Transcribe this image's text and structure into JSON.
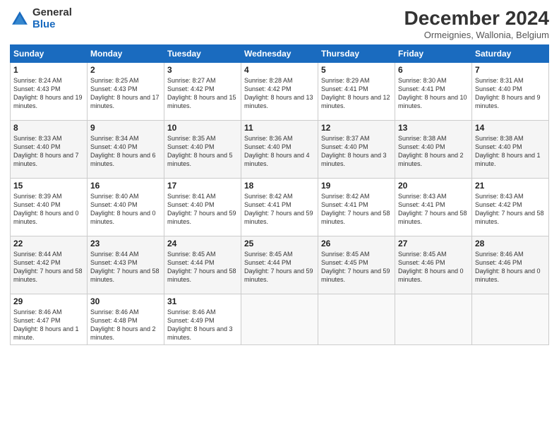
{
  "logo": {
    "general": "General",
    "blue": "Blue"
  },
  "header": {
    "month": "December 2024",
    "location": "Ormeignies, Wallonia, Belgium"
  },
  "weekdays": [
    "Sunday",
    "Monday",
    "Tuesday",
    "Wednesday",
    "Thursday",
    "Friday",
    "Saturday"
  ],
  "weeks": [
    [
      {
        "day": "1",
        "sunrise": "8:24 AM",
        "sunset": "4:43 PM",
        "daylight": "8 hours and 19 minutes."
      },
      {
        "day": "2",
        "sunrise": "8:25 AM",
        "sunset": "4:43 PM",
        "daylight": "8 hours and 17 minutes."
      },
      {
        "day": "3",
        "sunrise": "8:27 AM",
        "sunset": "4:42 PM",
        "daylight": "8 hours and 15 minutes."
      },
      {
        "day": "4",
        "sunrise": "8:28 AM",
        "sunset": "4:42 PM",
        "daylight": "8 hours and 13 minutes."
      },
      {
        "day": "5",
        "sunrise": "8:29 AM",
        "sunset": "4:41 PM",
        "daylight": "8 hours and 12 minutes."
      },
      {
        "day": "6",
        "sunrise": "8:30 AM",
        "sunset": "4:41 PM",
        "daylight": "8 hours and 10 minutes."
      },
      {
        "day": "7",
        "sunrise": "8:31 AM",
        "sunset": "4:40 PM",
        "daylight": "8 hours and 9 minutes."
      }
    ],
    [
      {
        "day": "8",
        "sunrise": "8:33 AM",
        "sunset": "4:40 PM",
        "daylight": "8 hours and 7 minutes."
      },
      {
        "day": "9",
        "sunrise": "8:34 AM",
        "sunset": "4:40 PM",
        "daylight": "8 hours and 6 minutes."
      },
      {
        "day": "10",
        "sunrise": "8:35 AM",
        "sunset": "4:40 PM",
        "daylight": "8 hours and 5 minutes."
      },
      {
        "day": "11",
        "sunrise": "8:36 AM",
        "sunset": "4:40 PM",
        "daylight": "8 hours and 4 minutes."
      },
      {
        "day": "12",
        "sunrise": "8:37 AM",
        "sunset": "4:40 PM",
        "daylight": "8 hours and 3 minutes."
      },
      {
        "day": "13",
        "sunrise": "8:38 AM",
        "sunset": "4:40 PM",
        "daylight": "8 hours and 2 minutes."
      },
      {
        "day": "14",
        "sunrise": "8:38 AM",
        "sunset": "4:40 PM",
        "daylight": "8 hours and 1 minute."
      }
    ],
    [
      {
        "day": "15",
        "sunrise": "8:39 AM",
        "sunset": "4:40 PM",
        "daylight": "8 hours and 0 minutes."
      },
      {
        "day": "16",
        "sunrise": "8:40 AM",
        "sunset": "4:40 PM",
        "daylight": "8 hours and 0 minutes."
      },
      {
        "day": "17",
        "sunrise": "8:41 AM",
        "sunset": "4:40 PM",
        "daylight": "7 hours and 59 minutes."
      },
      {
        "day": "18",
        "sunrise": "8:42 AM",
        "sunset": "4:41 PM",
        "daylight": "7 hours and 59 minutes."
      },
      {
        "day": "19",
        "sunrise": "8:42 AM",
        "sunset": "4:41 PM",
        "daylight": "7 hours and 58 minutes."
      },
      {
        "day": "20",
        "sunrise": "8:43 AM",
        "sunset": "4:41 PM",
        "daylight": "7 hours and 58 minutes."
      },
      {
        "day": "21",
        "sunrise": "8:43 AM",
        "sunset": "4:42 PM",
        "daylight": "7 hours and 58 minutes."
      }
    ],
    [
      {
        "day": "22",
        "sunrise": "8:44 AM",
        "sunset": "4:42 PM",
        "daylight": "7 hours and 58 minutes."
      },
      {
        "day": "23",
        "sunrise": "8:44 AM",
        "sunset": "4:43 PM",
        "daylight": "7 hours and 58 minutes."
      },
      {
        "day": "24",
        "sunrise": "8:45 AM",
        "sunset": "4:44 PM",
        "daylight": "7 hours and 58 minutes."
      },
      {
        "day": "25",
        "sunrise": "8:45 AM",
        "sunset": "4:44 PM",
        "daylight": "7 hours and 59 minutes."
      },
      {
        "day": "26",
        "sunrise": "8:45 AM",
        "sunset": "4:45 PM",
        "daylight": "7 hours and 59 minutes."
      },
      {
        "day": "27",
        "sunrise": "8:45 AM",
        "sunset": "4:46 PM",
        "daylight": "8 hours and 0 minutes."
      },
      {
        "day": "28",
        "sunrise": "8:46 AM",
        "sunset": "4:46 PM",
        "daylight": "8 hours and 0 minutes."
      }
    ],
    [
      {
        "day": "29",
        "sunrise": "8:46 AM",
        "sunset": "4:47 PM",
        "daylight": "8 hours and 1 minute."
      },
      {
        "day": "30",
        "sunrise": "8:46 AM",
        "sunset": "4:48 PM",
        "daylight": "8 hours and 2 minutes."
      },
      {
        "day": "31",
        "sunrise": "8:46 AM",
        "sunset": "4:49 PM",
        "daylight": "8 hours and 3 minutes."
      },
      null,
      null,
      null,
      null
    ]
  ]
}
